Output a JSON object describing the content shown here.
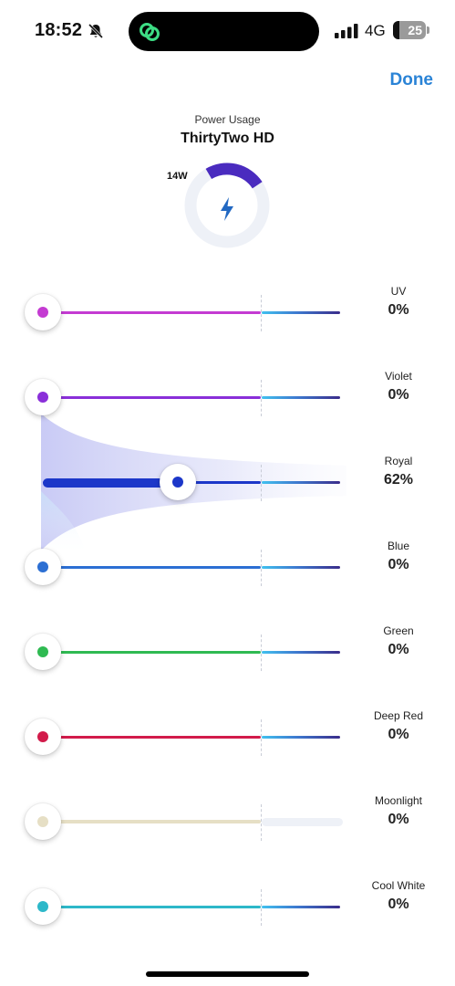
{
  "status": {
    "time": "18:52",
    "network": "4G",
    "battery": "25"
  },
  "header": {
    "done_label": "Done"
  },
  "power": {
    "label": "Power Usage",
    "device": "ThirtyTwo HD",
    "watts": "14W",
    "gauge_fraction": 0.24,
    "gauge_color": "#4a2bbf"
  },
  "channels": [
    {
      "name": "UV",
      "value": "0%",
      "level": 0,
      "color": "#c43bd2"
    },
    {
      "name": "Violet",
      "value": "0%",
      "level": 0,
      "color": "#8a2fd9"
    },
    {
      "name": "Royal",
      "value": "62%",
      "level": 0.62,
      "color": "#1c37c9"
    },
    {
      "name": "Blue",
      "value": "0%",
      "level": 0,
      "color": "#2c6fd3"
    },
    {
      "name": "Green",
      "value": "0%",
      "level": 0,
      "color": "#2fba52"
    },
    {
      "name": "Deep Red",
      "value": "0%",
      "level": 0,
      "color": "#d21b4a"
    },
    {
      "name": "Moonlight",
      "value": "0%",
      "level": 0,
      "color": "#e6dfc5"
    },
    {
      "name": "Cool White",
      "value": "0%",
      "level": 0,
      "color": "#2db8c9"
    }
  ]
}
